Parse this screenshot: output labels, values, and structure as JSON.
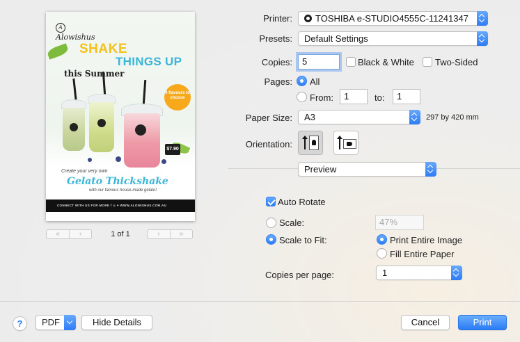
{
  "preview": {
    "poster": {
      "logo_text": "Alowishus",
      "headline_1": "SHAKE",
      "headline_2": "THINGS UP",
      "headline_3": "this Summer",
      "badge_text": "4 flavours to choose",
      "price": "$7.90",
      "tagline_1": "Create your very own",
      "tagline_2": "Gelato Thickshake",
      "tagline_3": "with our famous house-made gelato!",
      "footer": "CONNECT WITH US FOR MORE   f   ◎   ♥   WWW.ALOWISHUS.COM.AU"
    },
    "nav": {
      "first": "«",
      "prev": "‹",
      "next": "›",
      "last": "»",
      "page_indicator": "1 of 1"
    }
  },
  "form": {
    "printer": {
      "label": "Printer:",
      "value": "TOSHIBA e-STUDIO4555C-11241347"
    },
    "presets": {
      "label": "Presets:",
      "value": "Default Settings"
    },
    "copies": {
      "label": "Copies:",
      "value": "5",
      "bw_label": "Black & White",
      "bw_checked": false,
      "two_sided_label": "Two-Sided",
      "two_sided_checked": false
    },
    "pages": {
      "label": "Pages:",
      "all_label": "All",
      "all_selected": true,
      "from_label": "From:",
      "from_value": "1",
      "to_label": "to:",
      "to_value": "1"
    },
    "paper_size": {
      "label": "Paper Size:",
      "value": "A3",
      "dimensions": "297 by 420 mm"
    },
    "orientation": {
      "label": "Orientation:",
      "selected": "portrait"
    },
    "section_menu": {
      "value": "Preview"
    },
    "auto_rotate": {
      "label": "Auto Rotate",
      "checked": true
    },
    "scale": {
      "label": "Scale:",
      "value": "47%",
      "selected": false
    },
    "scale_to_fit": {
      "label": "Scale to Fit:",
      "selected": true,
      "print_entire_label": "Print Entire Image",
      "print_entire_selected": true,
      "fill_paper_label": "Fill Entire Paper",
      "fill_paper_selected": false
    },
    "copies_per_page": {
      "label": "Copies per page:",
      "value": "1"
    }
  },
  "footer": {
    "help": "?",
    "pdf": "PDF",
    "hide_details": "Hide Details",
    "cancel": "Cancel",
    "print": "Print"
  },
  "colors": {
    "accent": "#2f7ef5",
    "background": "#ececec"
  }
}
